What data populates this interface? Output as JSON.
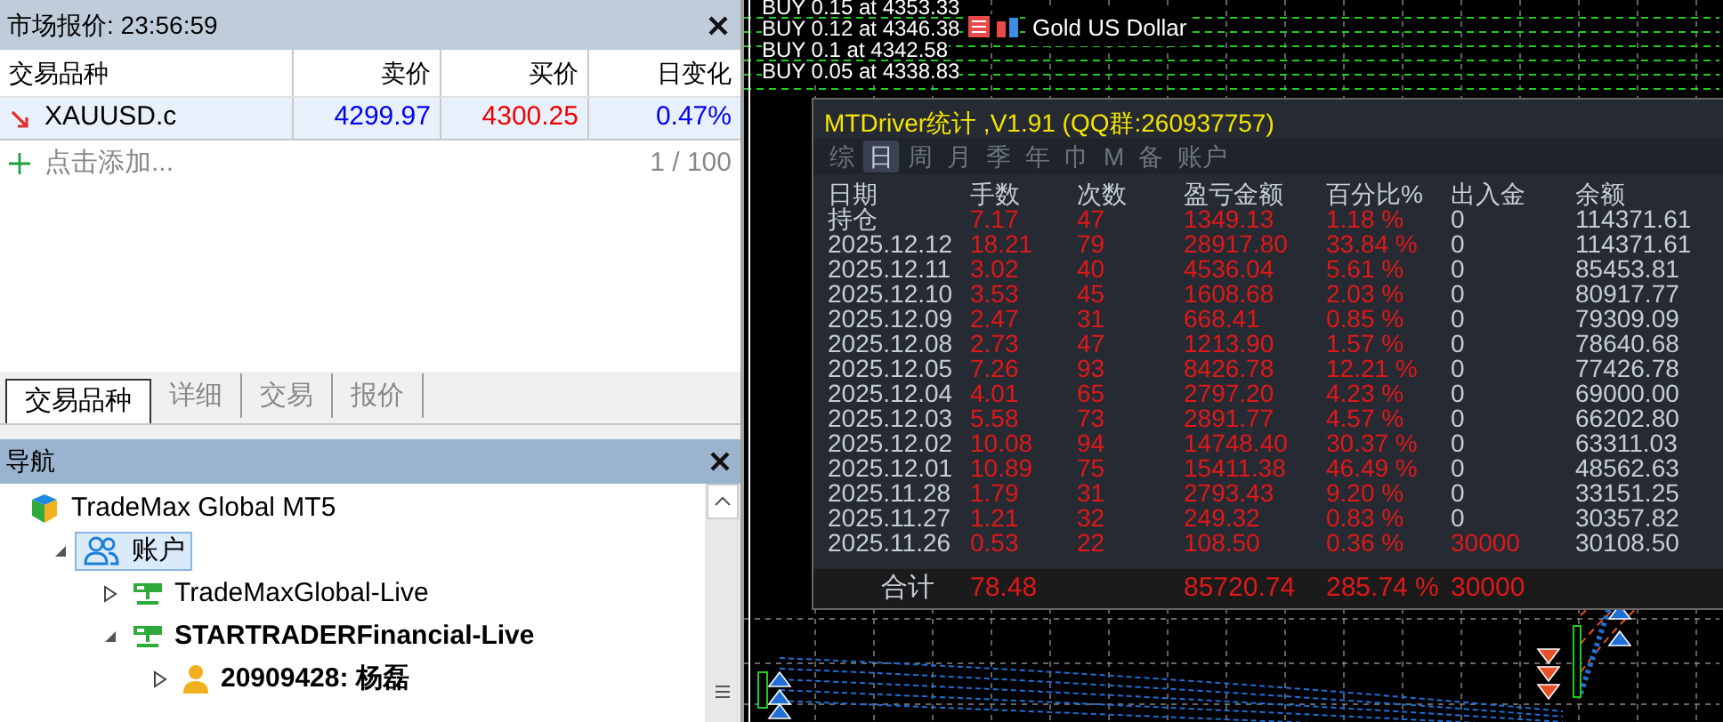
{
  "market_watch": {
    "title": "市场报价: 23:56:59",
    "columns": [
      "交易品种",
      "卖价",
      "买价",
      "日变化"
    ],
    "rows": [
      {
        "symbol": "XAUUSD.c",
        "bid": "4299.97",
        "ask": "4300.25",
        "change": "0.47%",
        "selected": true
      }
    ],
    "add_label": "点击添加...",
    "count": "1 / 100"
  },
  "bottom_tabs": [
    {
      "label": "交易品种",
      "selected": true
    },
    {
      "label": "详细",
      "selected": false
    },
    {
      "label": "交易",
      "selected": false
    },
    {
      "label": "报价",
      "selected": false
    }
  ],
  "navigator": {
    "title": "导航",
    "tree": [
      {
        "label": "TradeMax Global MT5",
        "kind": "broker",
        "bold": false,
        "selected": false,
        "children": [
          {
            "label": "账户",
            "kind": "accounts",
            "bold": false,
            "selected": true,
            "expanded": true,
            "children": [
              {
                "label": "TradeMaxGlobal-Live",
                "kind": "server",
                "bold": false,
                "selected": false,
                "expanded": false
              },
              {
                "label": "STARTRADERFinancial-Live",
                "kind": "server",
                "bold": true,
                "selected": false,
                "expanded": true,
                "children": [
                  {
                    "label": "20909428: 杨磊",
                    "kind": "user",
                    "bold": true,
                    "selected": false,
                    "expanded": false
                  }
                ]
              }
            ]
          }
        ]
      }
    ]
  },
  "chart": {
    "title": "Gold US Dollar",
    "trade_labels": [
      "BUY 0.15 at 4353.33",
      "BUY 0.12 at 4346.38",
      "BUY 0.1 at 4342.58",
      "BUY 0.05 at 4338.83"
    ]
  },
  "stats_panel": {
    "title": "MTDriver统计 ,V1.91 (QQ群:260937757)",
    "tabs": [
      {
        "label": "综",
        "selected": false
      },
      {
        "label": "日",
        "selected": true
      },
      {
        "label": "周",
        "selected": false
      },
      {
        "label": "月",
        "selected": false
      },
      {
        "label": "季",
        "selected": false
      },
      {
        "label": "年",
        "selected": false
      },
      {
        "label": "巾",
        "selected": false
      },
      {
        "label": "M",
        "selected": false
      },
      {
        "label": "备",
        "selected": false
      },
      {
        "label": "账户",
        "selected": false
      }
    ],
    "columns": [
      "日期",
      "手数",
      "次数",
      "盈亏金额",
      "百分比%",
      "出入金",
      "余额"
    ],
    "rows": [
      {
        "date": "持仓",
        "lots": "7.17",
        "trades": "47",
        "profit": "1349.13",
        "percent": "1.18 %",
        "deposit": "0",
        "balance": "114371.61"
      },
      {
        "date": "2025.12.12",
        "lots": "18.21",
        "trades": "79",
        "profit": "28917.80",
        "percent": "33.84 %",
        "deposit": "0",
        "balance": "114371.61"
      },
      {
        "date": "2025.12.11",
        "lots": "3.02",
        "trades": "40",
        "profit": "4536.04",
        "percent": "5.61 %",
        "deposit": "0",
        "balance": "85453.81"
      },
      {
        "date": "2025.12.10",
        "lots": "3.53",
        "trades": "45",
        "profit": "1608.68",
        "percent": "2.03 %",
        "deposit": "0",
        "balance": "80917.77"
      },
      {
        "date": "2025.12.09",
        "lots": "2.47",
        "trades": "31",
        "profit": "668.41",
        "percent": "0.85 %",
        "deposit": "0",
        "balance": "79309.09"
      },
      {
        "date": "2025.12.08",
        "lots": "2.73",
        "trades": "47",
        "profit": "1213.90",
        "percent": "1.57 %",
        "deposit": "0",
        "balance": "78640.68"
      },
      {
        "date": "2025.12.05",
        "lots": "7.26",
        "trades": "93",
        "profit": "8426.78",
        "percent": "12.21 %",
        "deposit": "0",
        "balance": "77426.78"
      },
      {
        "date": "2025.12.04",
        "lots": "4.01",
        "trades": "65",
        "profit": "2797.20",
        "percent": "4.23 %",
        "deposit": "0",
        "balance": "69000.00"
      },
      {
        "date": "2025.12.03",
        "lots": "5.58",
        "trades": "73",
        "profit": "2891.77",
        "percent": "4.57 %",
        "deposit": "0",
        "balance": "66202.80"
      },
      {
        "date": "2025.12.02",
        "lots": "10.08",
        "trades": "94",
        "profit": "14748.40",
        "percent": "30.37 %",
        "deposit": "0",
        "balance": "63311.03"
      },
      {
        "date": "2025.12.01",
        "lots": "10.89",
        "trades": "75",
        "profit": "15411.38",
        "percent": "46.49 %",
        "deposit": "0",
        "balance": "48562.63"
      },
      {
        "date": "2025.11.28",
        "lots": "1.79",
        "trades": "31",
        "profit": "2793.43",
        "percent": "9.20 %",
        "deposit": "0",
        "balance": "33151.25"
      },
      {
        "date": "2025.11.27",
        "lots": "1.21",
        "trades": "32",
        "profit": "249.32",
        "percent": "0.83 %",
        "deposit": "0",
        "balance": "30357.82"
      },
      {
        "date": "2025.11.26",
        "lots": "0.53",
        "trades": "22",
        "profit": "108.50",
        "percent": "0.36 %",
        "deposit": "30000",
        "balance": "30108.50"
      }
    ],
    "total": {
      "label": "合计",
      "lots": "78.48",
      "profit": "85720.74",
      "percent": "285.74 %",
      "deposit": "30000"
    }
  }
}
